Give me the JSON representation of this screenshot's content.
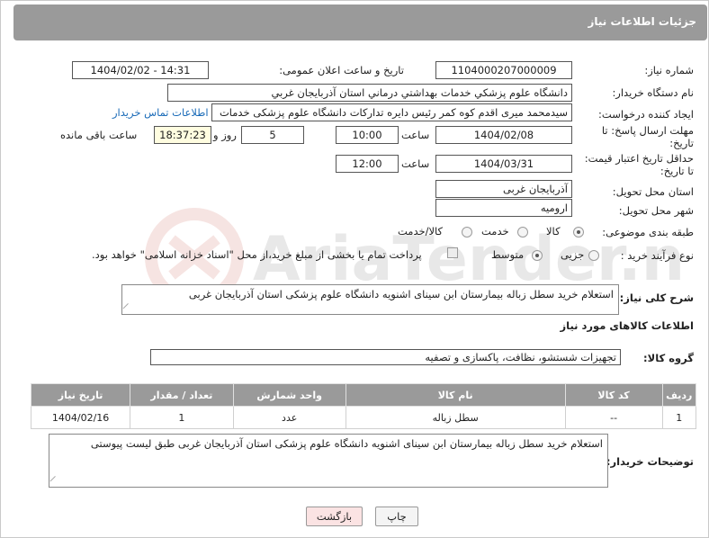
{
  "header": {
    "title": "جزئیات اطلاعات نیاز"
  },
  "fields": {
    "need_number_label": "شماره نیاز:",
    "need_number": "1104000207000009",
    "announce_label": "تاریخ و ساعت اعلان عمومی:",
    "announce_value": "1404/02/02 - 14:31",
    "buyer_org_label": "نام دستگاه خریدار:",
    "buyer_org": "دانشگاه علوم پزشكي خدمات بهداشتي درماني استان آذربايجان غربي",
    "requester_label": "ایجاد کننده درخواست:",
    "requester": "سیدمحمد میری اقدم کوه کمر رئیس دایره تدارکات دانشگاه علوم پزشکی خدمات",
    "contact_link": "اطلاعات تماس خریدار",
    "deadline_label": "مهلت ارسال پاسخ: تا تاریخ:",
    "deadline_date": "1404/02/08",
    "time_label": "ساعت",
    "deadline_time": "10:00",
    "days_value": "5",
    "days_label": "روز و",
    "remaining_time": "18:37:23",
    "remaining_label": "ساعت باقی مانده",
    "price_validity_label": "حداقل تاریخ اعتبار قیمت: تا تاریخ:",
    "price_date": "1404/03/31",
    "price_time": "12:00",
    "province_label": "استان محل تحویل:",
    "province": "آذربایجان غربی",
    "city_label": "شهر محل تحویل:",
    "city": "ارومیه",
    "category_label": "طبقه بندی موضوعی:",
    "category_options": [
      "کالا",
      "خدمت",
      "کالا/خدمت"
    ],
    "process_label": "نوع فرآیند خرید :",
    "process_options": [
      "جزیی",
      "متوسط"
    ],
    "payment_note": "پرداخت تمام یا بخشی از مبلغ خرید،از محل \"اسناد خزانه اسلامی\" خواهد بود.",
    "description_label": "شرح کلی نیاز:",
    "description": "استعلام خرید سطل زباله بیمارستان ابن سینای اشنویه دانشگاه علوم پزشکی استان آذربایجان غربی",
    "goods_info_title": "اطلاعات کالاهای مورد نیاز",
    "goods_group_label": "گروه کالا:",
    "goods_group": "تجهیزات شستشو، نظافت، پاکسازی و تصفیه",
    "buyer_notes_label": "توضیحات خریدار:",
    "buyer_notes": "استعلام خرید سطل زباله بیمارستان ابن سینای اشنویه دانشگاه علوم پزشکی استان آذربایجان غربی طبق لیست پیوستی"
  },
  "table": {
    "headers": [
      "ردیف",
      "کد کالا",
      "نام کالا",
      "واحد شمارش",
      "تعداد / مقدار",
      "تاریخ نیاز"
    ],
    "rows": [
      [
        "1",
        "--",
        "سطل زباله",
        "عدد",
        "1",
        "1404/02/16"
      ]
    ]
  },
  "buttons": {
    "print": "چاپ",
    "back": "بازگشت"
  },
  "watermark_text": "AriaTender.neT"
}
